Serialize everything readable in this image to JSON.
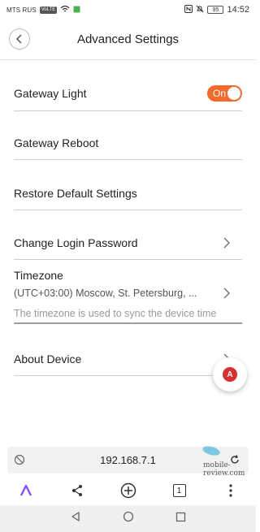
{
  "status_bar": {
    "carrier": "MTS RUS",
    "network_badge": "VoLTE",
    "battery": "95",
    "time": "14:52"
  },
  "header": {
    "title": "Advanced Settings"
  },
  "settings": {
    "gateway_light": {
      "label": "Gateway Light",
      "toggle": "On"
    },
    "gateway_reboot": {
      "label": "Gateway Reboot"
    },
    "restore_defaults": {
      "label": "Restore Default Settings"
    },
    "change_password": {
      "label": "Change Login Password"
    },
    "timezone": {
      "label": "Timezone",
      "value": "(UTC+03:00) Moscow, St. Petersburg, ...",
      "help": "The timezone is used to sync the device time"
    },
    "about_device": {
      "label": "About Device"
    }
  },
  "floating_badge": {
    "text": "A"
  },
  "browser": {
    "url": "192.168.7.1",
    "tab_count": "1",
    "watermark": "mobile-review.com"
  },
  "colors": {
    "toggle_on": "#f36a2c",
    "alice_purple": "#8a4dff"
  }
}
